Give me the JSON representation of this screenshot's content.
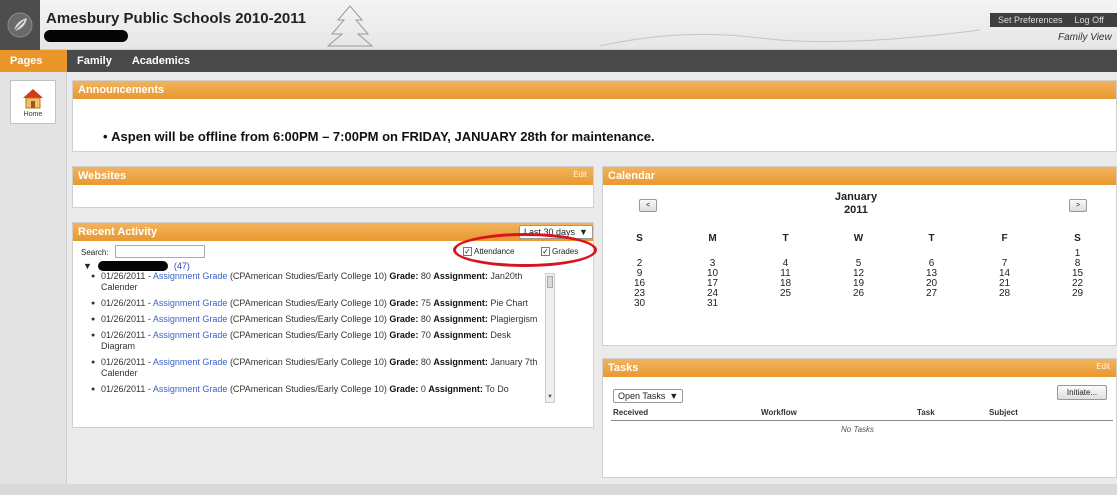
{
  "header": {
    "school_title": "Amesbury Public Schools 2010-2011",
    "set_preferences": "Set Preferences",
    "log_off": "Log Off",
    "view_label": "Family View"
  },
  "nav": {
    "tabs": [
      {
        "label": "Pages",
        "active": true
      },
      {
        "label": "Family",
        "active": false
      },
      {
        "label": "Academics",
        "active": false
      }
    ]
  },
  "left": {
    "home_label": "Home"
  },
  "announcements": {
    "title": "Announcements",
    "message": "Aspen will be offline from 6:00PM – 7:00PM on FRIDAY, JANUARY 28th for maintenance."
  },
  "websites": {
    "title": "Websites",
    "edit": "Edit"
  },
  "recent_activity": {
    "title": "Recent Activity",
    "range": "Last 30 days",
    "search_label": "Search:",
    "attendance_label": "Attendance",
    "grades_label": "Grades",
    "count": "(47)",
    "items": [
      {
        "date": "01/26/2011 - ",
        "type": "Assignment Grade",
        "course": " (CPAmerican Studies/Early College 10) ",
        "grade_label": "Grade:",
        "grade": " 80 ",
        "assign_label": "Assignment:",
        "assignment": " Jan20th Calender"
      },
      {
        "date": "01/26/2011 - ",
        "type": "Assignment Grade",
        "course": " (CPAmerican Studies/Early College 10) ",
        "grade_label": "Grade:",
        "grade": " 75 ",
        "assign_label": "Assignment:",
        "assignment": " Pie Chart"
      },
      {
        "date": "01/26/2011 - ",
        "type": "Assignment Grade",
        "course": " (CPAmerican Studies/Early College 10) ",
        "grade_label": "Grade:",
        "grade": " 80 ",
        "assign_label": "Assignment:",
        "assignment": " Plagiergism"
      },
      {
        "date": "01/26/2011 - ",
        "type": "Assignment Grade",
        "course": " (CPAmerican Studies/Early College 10) ",
        "grade_label": "Grade:",
        "grade": " 70 ",
        "assign_label": "Assignment:",
        "assignment": " Desk Diagram"
      },
      {
        "date": "01/26/2011 - ",
        "type": "Assignment Grade",
        "course": " (CPAmerican Studies/Early College 10) ",
        "grade_label": "Grade:",
        "grade": " 80 ",
        "assign_label": "Assignment:",
        "assignment": " January 7th Calender"
      },
      {
        "date": "01/26/2011 - ",
        "type": "Assignment Grade",
        "course": " (CPAmerican Studies/Early College 10) ",
        "grade_label": "Grade:",
        "grade": " 0 ",
        "assign_label": "Assignment:",
        "assignment": " To Do"
      }
    ]
  },
  "calendar": {
    "title": "Calendar",
    "month": "January",
    "year": "2011",
    "prev": "<",
    "next": ">",
    "weekdays": [
      "S",
      "M",
      "T",
      "W",
      "T",
      "F",
      "S"
    ],
    "weeks": [
      [
        "",
        "",
        "",
        "",
        "",
        "",
        "1"
      ],
      [
        "2",
        "3",
        "4",
        "5",
        "6",
        "7",
        "8"
      ],
      [
        "9",
        "10",
        "11",
        "12",
        "13",
        "14",
        "15"
      ],
      [
        "16",
        "17",
        "18",
        "19",
        "20",
        "21",
        "22"
      ],
      [
        "23",
        "24",
        "25",
        "26",
        "27",
        "28",
        "29"
      ],
      [
        "30",
        "31",
        "",
        "",
        "",
        "",
        ""
      ]
    ]
  },
  "tasks": {
    "title": "Tasks",
    "edit": "Edit",
    "filter": "Open Tasks",
    "initiate": "Initiate...",
    "columns": [
      "Received",
      "Workflow",
      "Task",
      "Subject"
    ],
    "empty": "No Tasks"
  },
  "colors": {
    "accent_orange": "#e8962a",
    "nav_dark": "#4a4a4a",
    "highlight_red": "#d8141d",
    "link_blue": "#3a5fcd"
  }
}
